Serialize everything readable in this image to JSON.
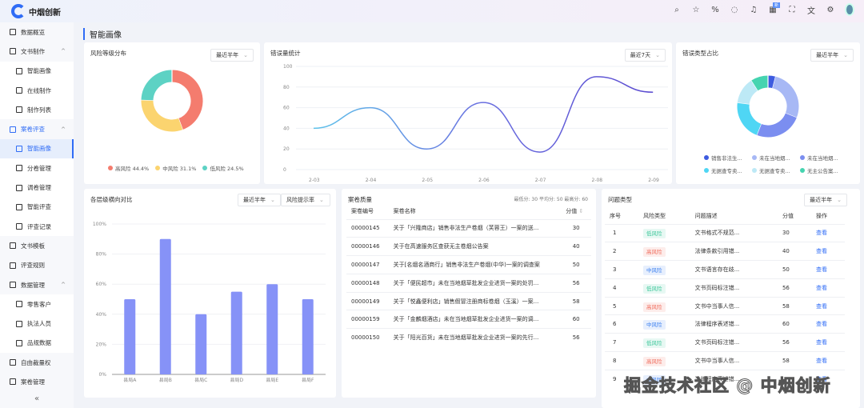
{
  "header": {
    "logo": "中烟创新",
    "badge": "新",
    "icons": [
      "search-icon",
      "star-icon",
      "percent-icon",
      "message-icon",
      "bell-icon",
      "apps-icon",
      "fullscreen-icon",
      "translate-icon",
      "settings-icon"
    ]
  },
  "sidebar": [
    {
      "label": "数据概览",
      "level": 0,
      "icon": "home-icon"
    },
    {
      "label": "文书制作",
      "level": 0,
      "icon": "grid-icon",
      "chev": "^"
    },
    {
      "label": "智能画像",
      "level": 1,
      "icon": "portrait-icon"
    },
    {
      "label": "在线制作",
      "level": 1,
      "icon": "window-icon"
    },
    {
      "label": "制作列表",
      "level": 1,
      "icon": "list-icon"
    },
    {
      "label": "案卷评查",
      "level": 0,
      "icon": "review-icon",
      "chev": "^",
      "on": true
    },
    {
      "label": "智能画像",
      "level": 1,
      "icon": "portrait-icon",
      "active": true
    },
    {
      "label": "分卷管理",
      "level": 1,
      "icon": "split-icon"
    },
    {
      "label": "调卷管理",
      "level": 1,
      "icon": "transfer-icon"
    },
    {
      "label": "智能评查",
      "level": 1,
      "icon": "smart-review-icon"
    },
    {
      "label": "评查记录",
      "level": 1,
      "icon": "record-icon"
    },
    {
      "label": "文书模板",
      "level": 0,
      "icon": "template-icon"
    },
    {
      "label": "评查规则",
      "level": 0,
      "icon": "rule-icon"
    },
    {
      "label": "数据管理",
      "level": 0,
      "icon": "cloud-icon",
      "chev": "^"
    },
    {
      "label": "零售客户",
      "level": 1,
      "icon": "customer-icon"
    },
    {
      "label": "执法人员",
      "level": 1,
      "icon": "user-icon"
    },
    {
      "label": "品规数据",
      "level": 1,
      "icon": "product-icon"
    },
    {
      "label": "自由裁量权",
      "level": 0,
      "icon": "discretion-icon"
    },
    {
      "label": "案卷管理",
      "level": 0,
      "icon": "case-icon"
    }
  ],
  "collapse": "«",
  "page_title": "智能画像",
  "risk": {
    "title": "风险等级分布",
    "select": "最近半年",
    "chart_data": {
      "type": "pie",
      "donut": true,
      "labels": [
        "高风险 44.4%",
        "中风险 31.1%",
        "低风险 24.5%"
      ],
      "values": [
        44.4,
        31.1,
        24.5
      ],
      "colors": [
        "#f47c6e",
        "#fbd46f",
        "#5dd2c4"
      ]
    }
  },
  "errors": {
    "title": "错误量统计",
    "select": "最近7天",
    "chart_data": {
      "type": "line",
      "x": [
        "2-03",
        "2-04",
        "2-05",
        "2-06",
        "2-07",
        "2-08",
        "2-09"
      ],
      "values": [
        40,
        60,
        20,
        65,
        17,
        90,
        75
      ],
      "ylim": [
        0,
        100
      ],
      "yticks": [
        "0",
        "20",
        "40",
        "60",
        "80",
        "100"
      ]
    }
  },
  "errtype": {
    "title": "错误类型占比",
    "select": "最近半年",
    "chart_data": {
      "type": "pie",
      "donut": true,
      "labels": [
        "销售非法生...",
        "未在当地烟...",
        "未在当地烟...",
        "无据查专卖...",
        "无据查专卖...",
        "无主公告案..."
      ],
      "values": [
        4,
        27,
        25,
        21,
        14,
        9
      ],
      "colors": [
        "#3d5be0",
        "#a7b8f5",
        "#7b8ef0",
        "#4fd6f4",
        "#bde9f6",
        "#45d4b0"
      ]
    }
  },
  "levels": {
    "title": "各层级横向对比",
    "select1": "最近半年",
    "select2": "风险提示率",
    "chart_data": {
      "type": "bar",
      "categories": [
        "县局A",
        "县局B",
        "县局C",
        "县局D",
        "县局E",
        "县局F"
      ],
      "values": [
        50,
        90,
        40,
        55,
        60,
        50
      ],
      "ylim": [
        0,
        100
      ],
      "yticks": [
        "0%",
        "20%",
        "40%",
        "60%",
        "80%",
        "100%"
      ]
    }
  },
  "quality": {
    "title": "案卷质量",
    "stats": "最低分: 30  平均分: 50  最高分: 60",
    "headers": [
      "案卷编号",
      "案卷名称",
      "分值"
    ],
    "rows": [
      [
        "00000145",
        "关于「兴隆商店」销售非法生产卷烟（芙蓉王）一案的送...",
        "30"
      ],
      [
        "00000146",
        "关于在高速服务区查获无主卷烟公告案",
        "40"
      ],
      [
        "00000147",
        "关于[名烟名酒商行」销售非法生产卷烟(中华)一案的调查案",
        "50"
      ],
      [
        "00000148",
        "关于「便民超市」未在当地烟草批发企业进货一案的处罚...",
        "56"
      ],
      [
        "00000149",
        "关于「悦鑫便利店」销售假冒注册商标卷烟（玉溪）一案...",
        "58"
      ],
      [
        "00000159",
        "关于「金麟烟酒店」未在当地烟草批发企业进货一案的调...",
        "60"
      ],
      [
        "00000150",
        "关于「阳光百货」未在当地烟草批发企业进货一案的先行...",
        "56"
      ]
    ]
  },
  "issues": {
    "title": "问题类型",
    "select": "最近半年",
    "headers": [
      "序号",
      "风险类型",
      "问题描述",
      "分值",
      "操作"
    ],
    "action": "查看",
    "rows": [
      [
        "1",
        "低风险",
        "文书格式不规范...",
        "30"
      ],
      [
        "2",
        "高风险",
        "法律条款引用错...",
        "40"
      ],
      [
        "3",
        "中风险",
        "文书语言存在歧...",
        "50"
      ],
      [
        "4",
        "低风险",
        "文书页码标注错...",
        "56"
      ],
      [
        "5",
        "高风险",
        "文书中当事人信...",
        "58"
      ],
      [
        "6",
        "中风险",
        "法律程序表述错...",
        "60"
      ],
      [
        "7",
        "低风险",
        "文书页码标注错...",
        "56"
      ],
      [
        "8",
        "高风险",
        "文书中当事人信...",
        "58"
      ],
      [
        "9",
        "中风险",
        "法律程序表述错...",
        ""
      ]
    ],
    "risk_colors": {
      "低风险": "#3cc79a",
      "高风险": "#f06a5a",
      "中风险": "#3a7ff0"
    }
  },
  "watermark": "掘金技术社区 @ 中烟创新"
}
